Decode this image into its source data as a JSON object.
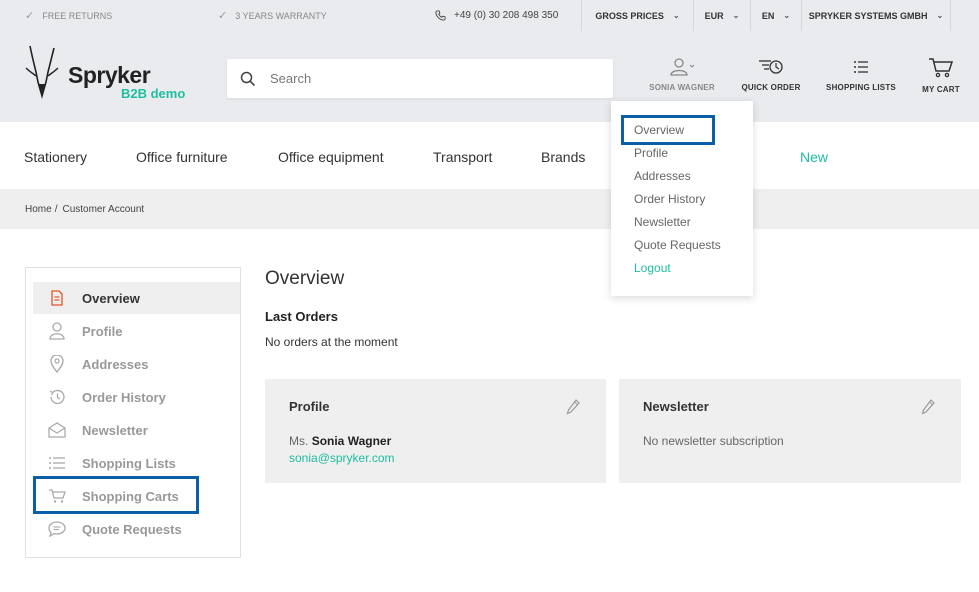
{
  "topbar": {
    "free_returns": "FREE RETURNS",
    "warranty": "3 YEARS WARRANTY",
    "phone": "+49 (0) 30 208 498 350",
    "price_mode": "GROSS PRICES",
    "currency": "EUR",
    "language": "EN",
    "company": "SPRYKER SYSTEMS GMBH"
  },
  "header": {
    "logo_text": "Spryker",
    "logo_sub": "B2B demo",
    "search_placeholder": "Search",
    "user_name": "SONIA WAGNER",
    "quick_order": "QUICK ORDER",
    "shopping_lists": "SHOPPING LISTS",
    "my_cart": "MY CART"
  },
  "categories": [
    "Stationery",
    "Office furniture",
    "Office equipment",
    "Transport",
    "Brands",
    "New"
  ],
  "breadcrumb": {
    "home": "Home",
    "sep": "/",
    "current": "Customer Account"
  },
  "user_dropdown": {
    "items": [
      "Overview",
      "Profile",
      "Addresses",
      "Order History",
      "Newsletter",
      "Quote Requests"
    ],
    "logout": "Logout"
  },
  "sidebar": {
    "items": [
      "Overview",
      "Profile",
      "Addresses",
      "Order History",
      "Newsletter",
      "Shopping Lists",
      "Shopping Carts",
      "Quote Requests"
    ],
    "active_index": 0
  },
  "main": {
    "title": "Overview",
    "last_orders_heading": "Last Orders",
    "no_orders": "No orders at the moment",
    "profile_card": {
      "title": "Profile",
      "salutation": "Ms.",
      "name": "Sonia Wagner",
      "email": "sonia@spryker.com"
    },
    "newsletter_card": {
      "title": "Newsletter",
      "status": "No newsletter subscription"
    }
  },
  "colors": {
    "accent": "#1ebea0",
    "highlight": "#0a5fa6",
    "active_icon": "#e2542b"
  }
}
